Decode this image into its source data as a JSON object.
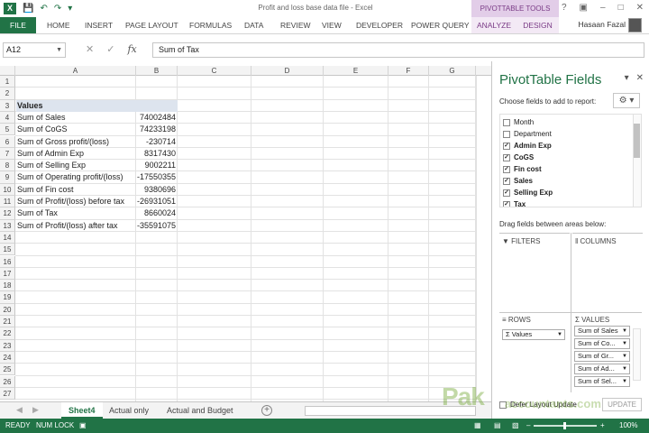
{
  "window": {
    "title": "Profit and loss base data file - Excel",
    "context_group": "PIVOTTABLE TOOLS",
    "user_name": "Hasaan Fazal"
  },
  "ribbon": {
    "file": "FILE",
    "tabs": [
      "HOME",
      "INSERT",
      "PAGE LAYOUT",
      "FORMULAS",
      "DATA",
      "REVIEW",
      "VIEW",
      "DEVELOPER",
      "POWER QUERY"
    ],
    "context_tabs": [
      "ANALYZE",
      "DESIGN"
    ]
  },
  "formula_bar": {
    "name_box": "A12",
    "formula": "Sum of Tax"
  },
  "grid": {
    "columns": [
      "A",
      "B",
      "C",
      "D",
      "E",
      "F",
      "G"
    ],
    "rows": [
      "1",
      "2",
      "3",
      "4",
      "5",
      "6",
      "7",
      "8",
      "9",
      "10",
      "11",
      "12",
      "13",
      "14",
      "15",
      "16",
      "17",
      "18",
      "19",
      "20",
      "21",
      "22",
      "23",
      "24",
      "25",
      "26",
      "27"
    ],
    "header_label": "Values",
    "data_rows": [
      {
        "label": "Sum of Sales",
        "value": "74002484"
      },
      {
        "label": "Sum of CoGS",
        "value": "74233198"
      },
      {
        "label": "Sum of Gross profit/(loss)",
        "value": "-230714"
      },
      {
        "label": "Sum of Admin Exp",
        "value": "8317430"
      },
      {
        "label": "Sum of Selling Exp",
        "value": "9002211"
      },
      {
        "label": "Sum of Operating profit/(loss)",
        "value": "-17550355"
      },
      {
        "label": "Sum of Fin cost",
        "value": "9380696"
      },
      {
        "label": "Sum of Profit/(loss) before tax",
        "value": "-26931051"
      },
      {
        "label": "Sum of Tax",
        "value": "8660024"
      },
      {
        "label": "Sum of Profit/(loss) after tax",
        "value": "-35591075"
      }
    ]
  },
  "sheets": {
    "tabs": [
      "Sheet4",
      "Actual only",
      "Actual and Budget"
    ],
    "active": "Sheet4"
  },
  "status": {
    "ready": "READY",
    "numlock": "NUM LOCK",
    "zoom": "100%"
  },
  "pivot_pane": {
    "title": "PivotTable Fields",
    "subtitle": "Choose fields to add to report:",
    "fields": [
      {
        "name": "Month",
        "checked": false
      },
      {
        "name": "Department",
        "checked": false
      },
      {
        "name": "Admin Exp",
        "checked": true
      },
      {
        "name": "CoGS",
        "checked": true
      },
      {
        "name": "Fin cost",
        "checked": true
      },
      {
        "name": "Sales",
        "checked": true
      },
      {
        "name": "Selling Exp",
        "checked": true
      },
      {
        "name": "Tax",
        "checked": true
      }
    ],
    "drag_hint": "Drag fields between areas below:",
    "areas": {
      "filters": "FILTERS",
      "columns": "COLUMNS",
      "rows": "ROWS",
      "values": "VALUES"
    },
    "rows_items": [
      "Values"
    ],
    "values_items": [
      "Sum of Sales",
      "Sum of Co...",
      "Sum of Gr...",
      "Sum of Ad...",
      "Sum of Sel..."
    ],
    "defer_label": "Defer Layout Update",
    "update_label": "UPDATE"
  },
  "watermark": {
    "text": "Pak",
    "suffix": "accountants.com"
  }
}
